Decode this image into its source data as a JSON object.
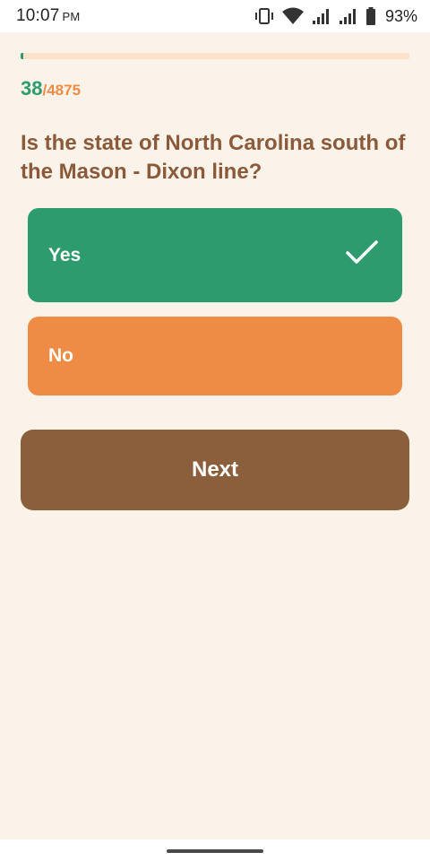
{
  "status_bar": {
    "time": "10:07",
    "ampm": "PM",
    "battery_percent": "93%"
  },
  "quiz": {
    "progress_fraction": 0.0078,
    "current": "38",
    "total": "/4875",
    "question": "Is the state of North Carolina south of the Mason - Dixon line?",
    "options": [
      {
        "label": "Yes",
        "selected": true
      },
      {
        "label": "No",
        "selected": false
      }
    ],
    "next_label": "Next"
  },
  "colors": {
    "background": "#fbf3ea",
    "correct_green": "#2e9b6e",
    "orange": "#ee8c45",
    "brown": "#8b5e3c",
    "question_text": "#8b5a3b",
    "progress_track": "#fbe2c8"
  },
  "icons": {
    "status": [
      "vibrate-icon",
      "wifi-icon",
      "signal-icon",
      "signal-icon",
      "battery-icon"
    ],
    "selected_option": "checkmark-icon"
  }
}
